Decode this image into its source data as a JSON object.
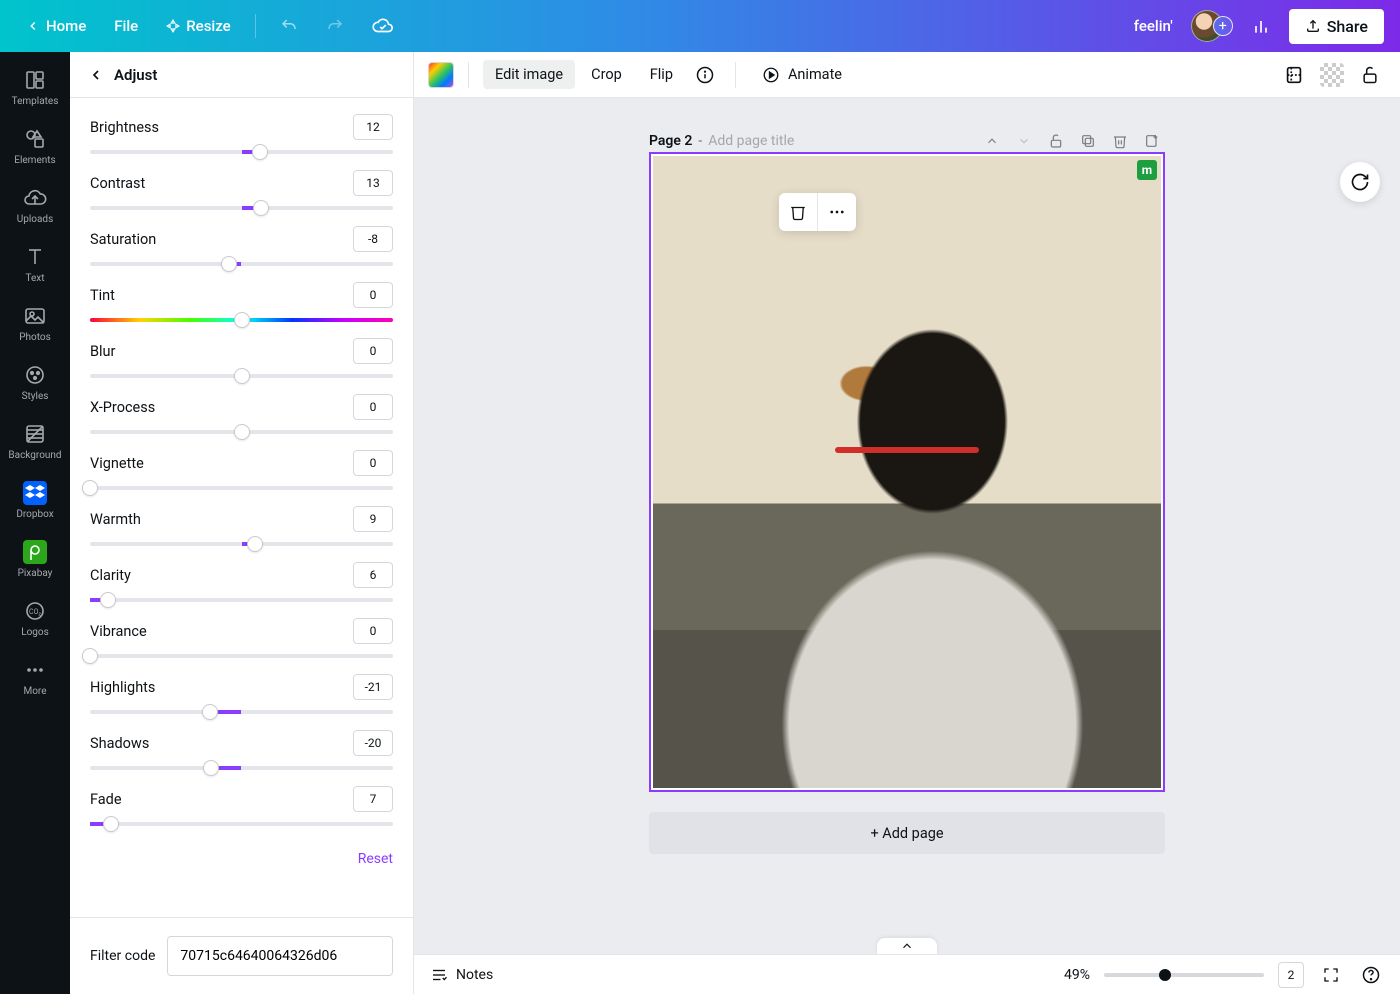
{
  "topbar": {
    "home": "Home",
    "file": "File",
    "resize": "Resize",
    "project_name": "feelin'",
    "share": "Share"
  },
  "leftrail": {
    "items": [
      {
        "label": "Templates",
        "icon": "templates"
      },
      {
        "label": "Elements",
        "icon": "elements"
      },
      {
        "label": "Uploads",
        "icon": "uploads"
      },
      {
        "label": "Text",
        "icon": "text"
      },
      {
        "label": "Photos",
        "icon": "photos"
      },
      {
        "label": "Styles",
        "icon": "styles"
      },
      {
        "label": "Background",
        "icon": "background"
      },
      {
        "label": "Dropbox",
        "icon": "dropbox"
      },
      {
        "label": "Pixabay",
        "icon": "pixabay"
      },
      {
        "label": "Logos",
        "icon": "logos"
      },
      {
        "label": "More",
        "icon": "more"
      }
    ]
  },
  "panel": {
    "title": "Adjust",
    "sliders": [
      {
        "label": "Brightness",
        "value": "12",
        "min": -100,
        "max": 100,
        "pos": 56,
        "fill_from": 50,
        "type": "center"
      },
      {
        "label": "Contrast",
        "value": "13",
        "min": -100,
        "max": 100,
        "pos": 56.5,
        "fill_from": 50,
        "type": "center"
      },
      {
        "label": "Saturation",
        "value": "-8",
        "min": -100,
        "max": 100,
        "pos": 46,
        "fill_from": 50,
        "type": "center"
      },
      {
        "label": "Tint",
        "value": "0",
        "min": -100,
        "max": 100,
        "pos": 50,
        "fill_from": 50,
        "type": "rainbow"
      },
      {
        "label": "Blur",
        "value": "0",
        "min": -100,
        "max": 100,
        "pos": 50,
        "fill_from": 50,
        "type": "center"
      },
      {
        "label": "X-Process",
        "value": "0",
        "min": -100,
        "max": 100,
        "pos": 50,
        "fill_from": 50,
        "type": "center"
      },
      {
        "label": "Vignette",
        "value": "0",
        "min": 0,
        "max": 100,
        "pos": 0,
        "fill_from": 0,
        "type": "left"
      },
      {
        "label": "Warmth",
        "value": "9",
        "min": -100,
        "max": 100,
        "pos": 54.5,
        "fill_from": 50,
        "type": "center"
      },
      {
        "label": "Clarity",
        "value": "6",
        "min": 0,
        "max": 100,
        "pos": 6,
        "fill_from": 0,
        "type": "left"
      },
      {
        "label": "Vibrance",
        "value": "0",
        "min": 0,
        "max": 100,
        "pos": 0,
        "fill_from": 0,
        "type": "left"
      },
      {
        "label": "Highlights",
        "value": "-21",
        "min": -100,
        "max": 100,
        "pos": 39.5,
        "fill_from": 50,
        "type": "center"
      },
      {
        "label": "Shadows",
        "value": "-20",
        "min": -100,
        "max": 100,
        "pos": 40,
        "fill_from": 50,
        "type": "center"
      },
      {
        "label": "Fade",
        "value": "7",
        "min": 0,
        "max": 100,
        "pos": 7,
        "fill_from": 0,
        "type": "left"
      }
    ],
    "reset": "Reset",
    "filter_code_label": "Filter code",
    "filter_code_value": "70715c64640064326d06"
  },
  "context": {
    "edit_image": "Edit image",
    "crop": "Crop",
    "flip": "Flip",
    "animate": "Animate"
  },
  "canvas": {
    "page_label": "Page 2",
    "title_placeholder": "Add page title",
    "badge": "m",
    "add_page": "+ Add page"
  },
  "status": {
    "notes": "Notes",
    "zoom": "49%",
    "page_count": "2"
  }
}
